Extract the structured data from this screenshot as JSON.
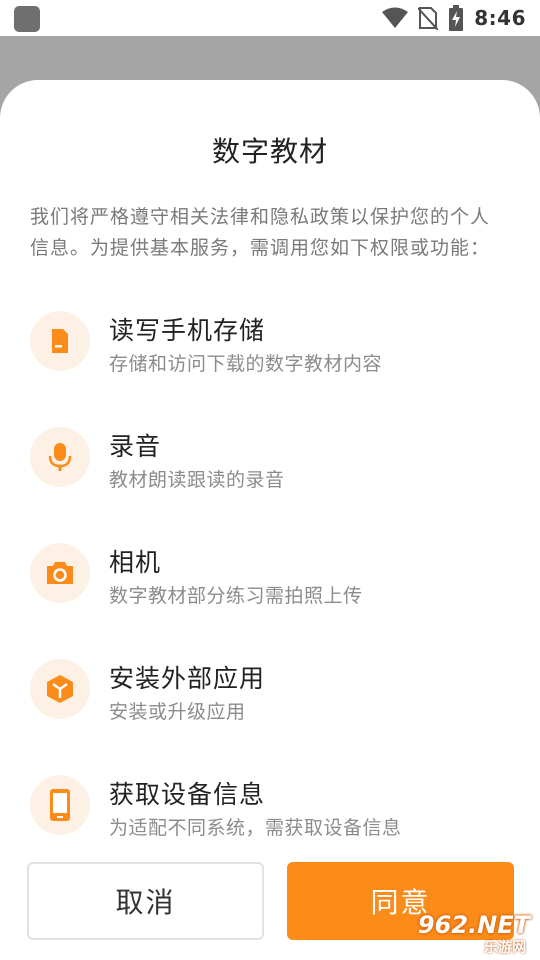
{
  "status_bar": {
    "time": "8:46",
    "icons": [
      "app-square-icon",
      "wifi-icon",
      "no-sim-icon",
      "battery-charging-icon"
    ]
  },
  "dialog": {
    "title": "数字教材",
    "intro": "我们将严格遵守相关法律和隐私政策以保护您的个人信息。为提供基本服务，需调用您如下权限或功能：",
    "permissions": [
      {
        "icon": "sd-card-icon",
        "title": "读写手机存储",
        "desc": "存储和访问下载的数字教材内容"
      },
      {
        "icon": "microphone-icon",
        "title": "录音",
        "desc": "教材朗读跟读的录音"
      },
      {
        "icon": "camera-icon",
        "title": "相机",
        "desc": "数字教材部分练习需拍照上传"
      },
      {
        "icon": "package-icon",
        "title": "安装外部应用",
        "desc": "安装或升级应用"
      },
      {
        "icon": "phone-icon",
        "title": "获取设备信息",
        "desc": "为适配不同系统，需获取设备信息"
      }
    ],
    "cancel_label": "取消",
    "agree_label": "同意"
  },
  "watermark": {
    "brand": "962.NET",
    "sub": "乐游网"
  },
  "colors": {
    "accent": "#fb8c1a",
    "icon_bg": "#fdf1e6",
    "backdrop": "#a5a5a5"
  }
}
